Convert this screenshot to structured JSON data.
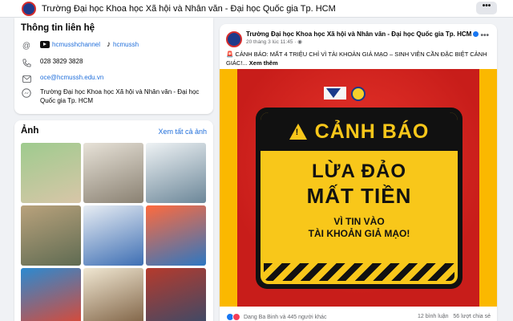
{
  "header": {
    "page_name": "Trường Đại học Khoa học Xã hội và Nhân văn - Đại học Quốc gia Tp. HCM",
    "more_label": "•••"
  },
  "contact": {
    "title": "Thông tin liên hệ",
    "youtube": "hcmusshchannel",
    "tiktok": "hcmussh",
    "phone": "028 3829 3828",
    "email": "oce@hcmussh.edu.vn",
    "messenger": "Trường Đại học Khoa học Xã hội và Nhân văn - Đại học Quốc gia Tp. HCM"
  },
  "photos": {
    "title": "Ảnh",
    "see_all": "Xem tất cả ảnh",
    "items": [
      {
        "colors": [
          "#9ecb8e",
          "#d8c6a8"
        ]
      },
      {
        "colors": [
          "#e7e2d8",
          "#8a8172"
        ]
      },
      {
        "colors": [
          "#eef2f4",
          "#6c8799"
        ]
      },
      {
        "colors": [
          "#b9a27c",
          "#5f6b52"
        ]
      },
      {
        "colors": [
          "#e8edf3",
          "#3e6fb4"
        ]
      },
      {
        "colors": [
          "#ff6a3d",
          "#2d77c2"
        ]
      },
      {
        "colors": [
          "#2b8ad1",
          "#e3462f"
        ]
      },
      {
        "colors": [
          "#f0e7d2",
          "#7a5c3e"
        ]
      },
      {
        "colors": [
          "#b63a2c",
          "#364b6b"
        ]
      }
    ]
  },
  "post": {
    "author": "Trường Đại học Khoa học Xã hội và Nhân văn - Đại học Quốc gia Tp. HCM",
    "meta": "20 tháng 3 lúc 11:45 · ",
    "more": "•••",
    "text": "🚨 CẢNH BÁO: MẤT 4 TRIỆU CHỈ VÌ TÀI KHOẢN GIẢ MẠO – SINH VIÊN CẦN ĐẶC BIỆT CẢNH GIÁC!... ",
    "see_more": "Xem thêm",
    "banner": {
      "headline": "CẢNH BÁO",
      "line1": "LỪA ĐẢO",
      "line2": "MẤT TIỀN",
      "line3": "VÌ TIN VÀO",
      "line4": "TÀI KHOẢN GIẢ MẠO!",
      "warn_symbol": "!"
    },
    "reactions": "Dang Ba Binh và 445 người khác",
    "comments": "12 bình luận",
    "shares": "56 lượt chia sẻ",
    "accent": "#1877f2"
  }
}
